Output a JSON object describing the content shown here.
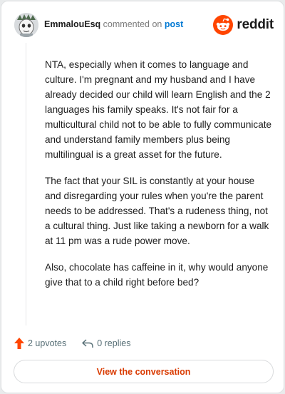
{
  "header": {
    "username": "EmmalouEsq",
    "action": "commented on",
    "post_link": "post",
    "brand": "reddit"
  },
  "comment": {
    "paragraphs": [
      "NTA, especially when it comes to language and culture. I'm pregnant and my husband and I have already decided our child will learn English and the 2 languages his family speaks. It's not fair for a multicultural child not to be able to fully communicate and understand family members plus being multilingual is a great asset for the future.",
      "The fact that your SIL is constantly at your house and disregarding your rules when you're the parent needs to be addressed. That's a rudeness thing, not a cultural thing. Just like taking a newborn for a walk at 11 pm was a rude power move.",
      "Also, chocolate has caffeine in it, why would anyone give that to a child right before bed?"
    ]
  },
  "actions": {
    "upvotes": "2 upvotes",
    "replies": "0 replies"
  },
  "cta": {
    "label": "View the conversation"
  },
  "colors": {
    "brand_orange": "#ff4500",
    "upvote": "#ff4500",
    "link_blue": "#0079d3",
    "cta_text": "#d93a00"
  },
  "icons": [
    "avatar",
    "reddit-logo-icon",
    "upvote-arrow-icon",
    "reply-icon"
  ]
}
